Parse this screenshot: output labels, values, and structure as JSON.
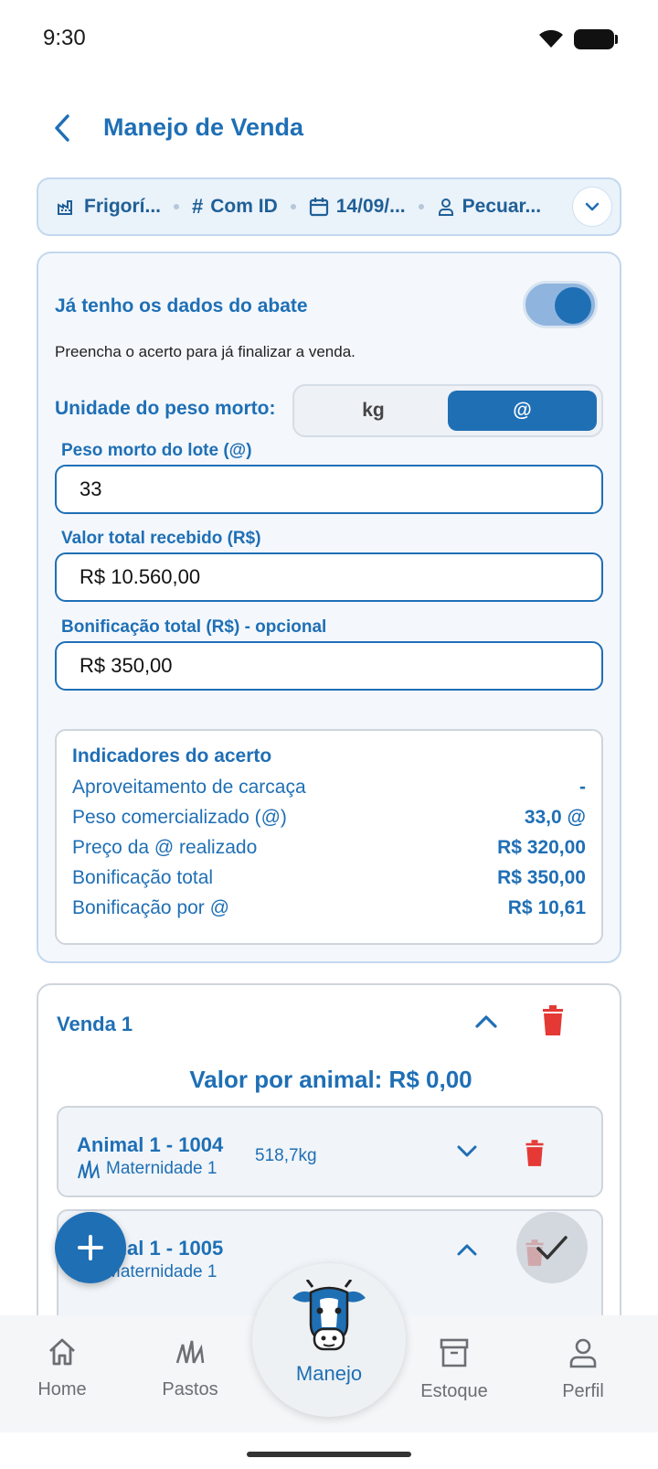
{
  "status_bar": {
    "time": "9:30"
  },
  "header": {
    "title": "Manejo de Venda"
  },
  "summary": {
    "destination": "Frigorí...",
    "identification": "Com ID",
    "date": "14/09/...",
    "buyer": "Pecuar..."
  },
  "settlement": {
    "toggle_label": "Já tenho os dados do abate",
    "toggle_on": true,
    "hint": "Preencha o acerto para já finalizar a venda.",
    "unit_label": "Unidade do peso morto:",
    "unit_options": [
      "kg",
      "@"
    ],
    "unit_selected": "@",
    "carcass_weight_label": "Peso morto do lote (@)",
    "carcass_weight_value": "33",
    "total_received_label": "Valor total recebido (R$)",
    "total_received_value": "R$ 10.560,00",
    "bonus_label": "Bonificação total (R$) - opcional",
    "bonus_value": "R$ 350,00"
  },
  "indicators": {
    "title": "Indicadores do acerto",
    "rows": [
      {
        "label": "Aproveitamento de carcaça",
        "value": "-"
      },
      {
        "label": "Peso comercializado (@)",
        "value": "33,0 @"
      },
      {
        "label": "Preço da @ realizado",
        "value": "R$ 320,00"
      },
      {
        "label": "Bonificação total",
        "value": "R$ 350,00"
      },
      {
        "label": "Bonificação por @",
        "value": "R$ 10,61"
      }
    ]
  },
  "sale": {
    "title": "Venda 1",
    "value_per_animal": "Valor por animal: R$ 0,00",
    "animals": [
      {
        "name": "Animal 1 - 1004",
        "pasture": "Maternidade 1",
        "weight": "518,7kg",
        "expanded": false
      },
      {
        "name": "Animal 1 - 1005",
        "pasture": "Maternidade 1",
        "weight": "",
        "expanded": true
      }
    ]
  },
  "bottom_nav": {
    "items": [
      {
        "label": "Home",
        "icon": "home-icon"
      },
      {
        "label": "Pastos",
        "icon": "grass-icon"
      },
      {
        "label": "Manejo",
        "icon": "cow-icon"
      },
      {
        "label": "Estoque",
        "icon": "archive-box-icon"
      },
      {
        "label": "Perfil",
        "icon": "person-icon"
      }
    ]
  },
  "colors": {
    "primary": "#1f6fb5",
    "danger": "#e53935",
    "surface": "#f4f8fc"
  }
}
